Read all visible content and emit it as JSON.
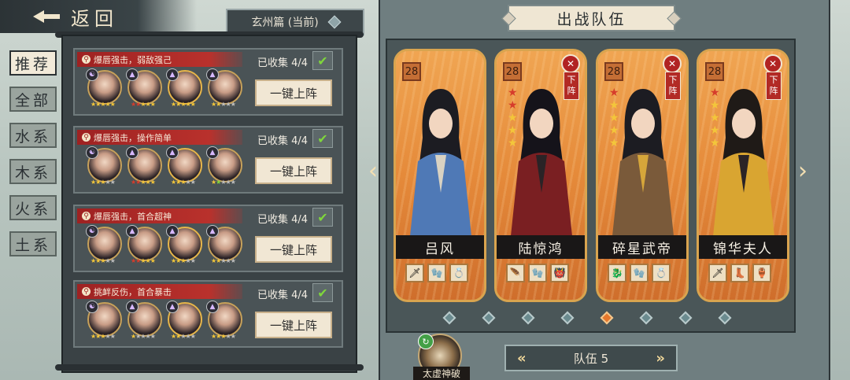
{
  "header": {
    "back_label": "返回",
    "chapter_label": "玄州篇 (当前)"
  },
  "tabs": [
    "推荐",
    "全部",
    "水系",
    "木系",
    "火系",
    "土系"
  ],
  "teams": [
    {
      "tag": "爆唇强击，弱敌强己",
      "collected": "已收集 4/4",
      "deploy": "一键上阵",
      "heroes": [
        {
          "stars": "★★★★★",
          "colors": [
            "#f3c63a",
            "#f3c63a",
            "#f3c63a",
            "#f3c63a",
            "#f3c63a"
          ]
        },
        {
          "stars": "★★★★★",
          "colors": [
            "#d63c2b",
            "#d63c2b",
            "#f3c63a",
            "#f3c63a",
            "#f3c63a"
          ]
        },
        {
          "stars": "★★★★★",
          "colors": [
            "#f3c63a",
            "#f3c63a",
            "#f3c63a",
            "#f3c63a",
            "#f3c63a"
          ]
        },
        {
          "stars": "★★★★★",
          "colors": [
            "#f3c63a",
            "#f3c63a",
            "#bdbdbd",
            "#bdbdbd",
            "#bdbdbd"
          ]
        }
      ]
    },
    {
      "tag": "爆唇强击，操作简单",
      "collected": "已收集 4/4",
      "deploy": "一键上阵",
      "heroes": [
        {
          "stars": "★★★★★",
          "colors": [
            "#f3c63a",
            "#f3c63a",
            "#f3c63a",
            "#bdbdbd",
            "#bdbdbd"
          ]
        },
        {
          "stars": "★★★★★",
          "colors": [
            "#d63c2b",
            "#d63c2b",
            "#f3c63a",
            "#f3c63a",
            "#f3c63a"
          ]
        },
        {
          "stars": "★★★★★",
          "colors": [
            "#f3c63a",
            "#f3c63a",
            "#f3c63a",
            "#bdbdbd",
            "#bdbdbd"
          ]
        },
        {
          "stars": "★★★★★",
          "colors": [
            "#f3c63a",
            "#7fd63c",
            "#bdbdbd",
            "#bdbdbd",
            "#bdbdbd"
          ]
        }
      ]
    },
    {
      "tag": "爆唇强击，首合超神",
      "collected": "已收集 4/4",
      "deploy": "一键上阵",
      "heroes": [
        {
          "stars": "★★★★★",
          "colors": [
            "#f3c63a",
            "#f3c63a",
            "#f3c63a",
            "#bdbdbd",
            "#bdbdbd"
          ]
        },
        {
          "stars": "★★★★★",
          "colors": [
            "#d63c2b",
            "#d63c2b",
            "#f3c63a",
            "#f3c63a",
            "#f3c63a"
          ]
        },
        {
          "stars": "★★★★★",
          "colors": [
            "#f3c63a",
            "#f3c63a",
            "#f3c63a",
            "#bdbdbd",
            "#bdbdbd"
          ]
        },
        {
          "stars": "★★★★★",
          "colors": [
            "#f3c63a",
            "#f3c63a",
            "#bdbdbd",
            "#bdbdbd",
            "#bdbdbd"
          ]
        }
      ]
    },
    {
      "tag": "挑衅反伤，首合暴击",
      "collected": "已收集 4/4",
      "deploy": "一键上阵",
      "heroes": [
        {
          "stars": "★★★★★",
          "colors": [
            "#f3c63a",
            "#f3c63a",
            "#f3c63a",
            "#bdbdbd",
            "#bdbdbd"
          ]
        },
        {
          "stars": "★★★★★",
          "colors": [
            "#f3c63a",
            "#bdbdbd",
            "#bdbdbd",
            "#bdbdbd",
            "#bdbdbd"
          ]
        },
        {
          "stars": "★★★★★",
          "colors": [
            "#f3c63a",
            "#f3c63a",
            "#bdbdbd",
            "#bdbdbd",
            "#bdbdbd"
          ]
        },
        {
          "stars": "★★★★★",
          "colors": [
            "#f3c63a",
            "#f3c63a",
            "#f3c63a",
            "#bdbdbd",
            "#bdbdbd"
          ]
        }
      ]
    }
  ],
  "lineup": {
    "title": "出战队伍",
    "team_label": "队伍 5",
    "skill_label": "太虚神破",
    "page_active_index": 4,
    "page_count": 8,
    "cards": [
      {
        "name": "吕风",
        "level": "28",
        "stars": [],
        "removable": false,
        "dismiss": "",
        "equip": [
          "🗡",
          "🧤",
          "💍"
        ]
      },
      {
        "name": "陆惊鸿",
        "level": "28",
        "stars": [
          "#d63c2b",
          "#d63c2b",
          "#f3c63a",
          "#f3c63a",
          "#f3c63a"
        ],
        "removable": true,
        "dismiss": "下阵",
        "equip": [
          "🪶",
          "🧤",
          "👹"
        ]
      },
      {
        "name": "碎星武帝",
        "level": "28",
        "stars": [
          "#d63c2b",
          "#f3c63a",
          "#f3c63a",
          "#f3c63a",
          "#f3c63a"
        ],
        "removable": true,
        "dismiss": "下阵",
        "equip": [
          "🐉",
          "🧤",
          "💍"
        ]
      },
      {
        "name": "锦华夫人",
        "level": "28",
        "stars": [
          "#d63c2b",
          "#f3c63a",
          "#f3c63a",
          "#f3c63a",
          "#f3c63a"
        ],
        "removable": true,
        "dismiss": "下阵",
        "equip": [
          "🗡",
          "👢",
          "🏺"
        ]
      }
    ]
  }
}
